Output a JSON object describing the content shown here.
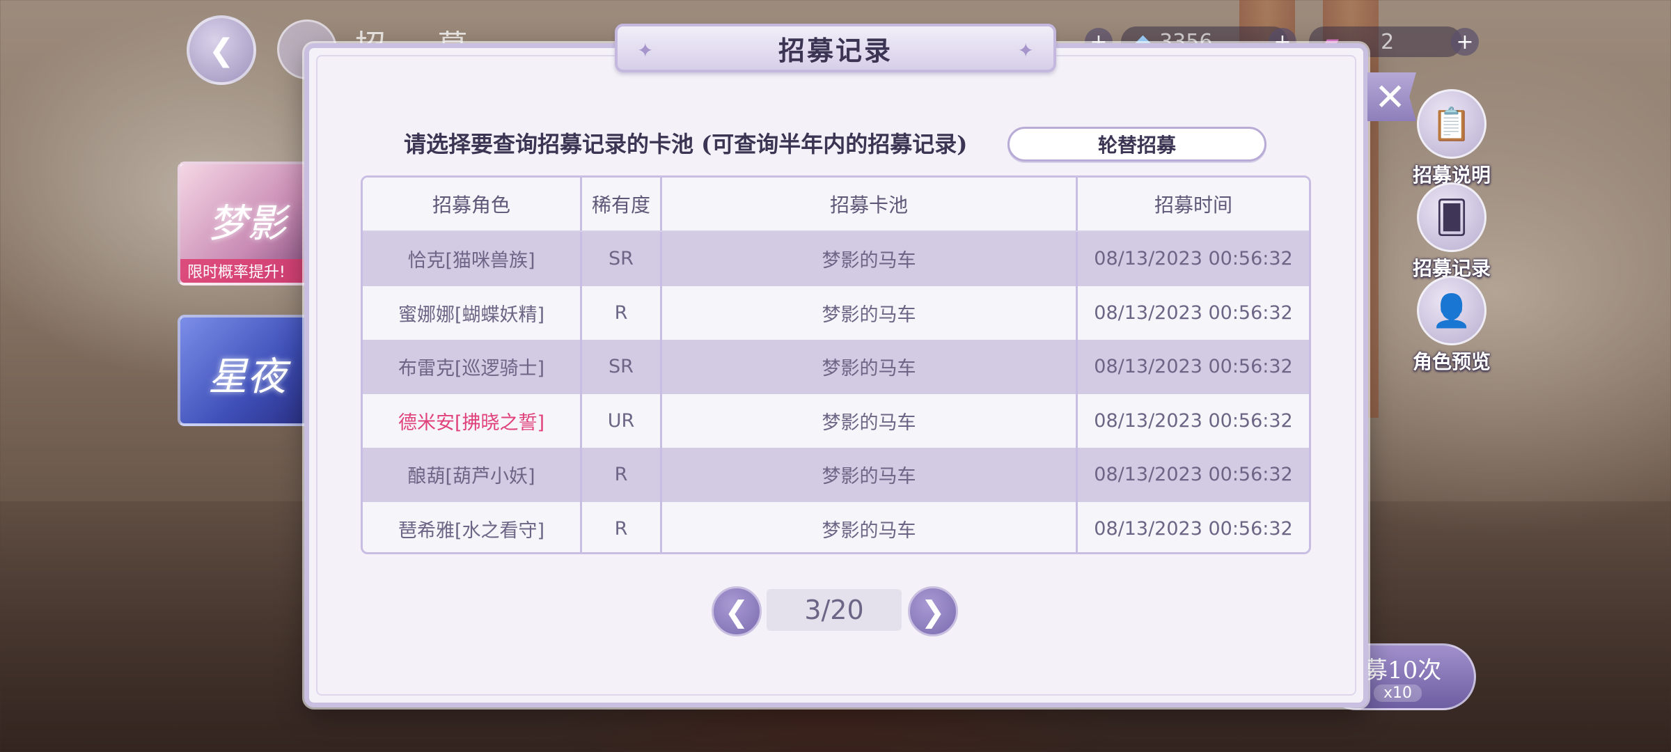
{
  "hud": {
    "title": "招 募",
    "currency_1": "3356",
    "currency_2": "2",
    "plus": "+"
  },
  "icons": {
    "back": "back-arrow-icon",
    "home": "home-icon",
    "close": "close-icon",
    "rules": "clipboard-icon",
    "records": "cards-icon",
    "preview": "person-icon",
    "prev": "chevron-left-icon",
    "next": "chevron-right-icon",
    "star": "sparkle-icon"
  },
  "banners": {
    "first_tag": "限时概率提升!",
    "first_text": "梦影",
    "second_text": "星夜"
  },
  "side_menu": {
    "rules_label": "招募说明",
    "records_label": "招募记录",
    "preview_label": "角色预览"
  },
  "recruit_button": {
    "label": "募10次",
    "cost": "x10"
  },
  "modal": {
    "title": "招募记录",
    "prompt": "请选择要查询招募记录的卡池 (可查询半年内的招募记录)",
    "pool_selected": "轮替招募",
    "columns": [
      "招募角色",
      "稀有度",
      "招募卡池",
      "招募时间"
    ],
    "rows": [
      {
        "character": "恰克[猫咪兽族]",
        "rarity": "SR",
        "pool": "梦影的马车",
        "time": "08/13/2023 00:56:32"
      },
      {
        "character": "蜜娜娜[蝴蝶妖精]",
        "rarity": "R",
        "pool": "梦影的马车",
        "time": "08/13/2023 00:56:32"
      },
      {
        "character": "布雷克[巡逻骑士]",
        "rarity": "SR",
        "pool": "梦影的马车",
        "time": "08/13/2023 00:56:32"
      },
      {
        "character": "德米安[拂晓之誓]",
        "rarity": "UR",
        "pool": "梦影的马车",
        "time": "08/13/2023 00:56:32"
      },
      {
        "character": "酿葫[葫芦小妖]",
        "rarity": "R",
        "pool": "梦影的马车",
        "time": "08/13/2023 00:56:32"
      },
      {
        "character": "琶希雅[水之看守]",
        "rarity": "R",
        "pool": "梦影的马车",
        "time": "08/13/2023 00:56:32"
      }
    ],
    "page_indicator": "3/20"
  },
  "colors": {
    "accent": "#8e7fbb",
    "ur_highlight": "#e0417a",
    "row_shade": "#d2cbe3",
    "panel_bg": "#f4f2f8"
  }
}
